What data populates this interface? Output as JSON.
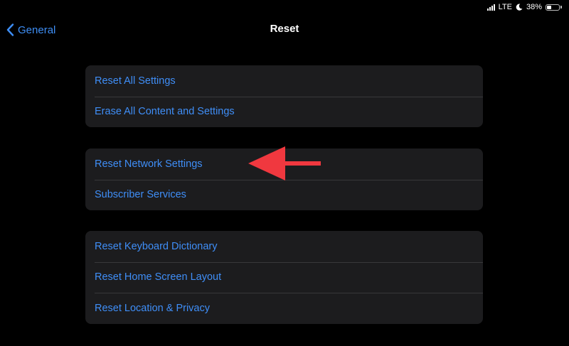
{
  "status_bar": {
    "network": "LTE",
    "battery_percent": "38%",
    "battery_level": 0.38,
    "signal_icon": "signal-bars-icon",
    "moon_icon": "do-not-disturb-moon-icon",
    "battery_icon": "battery-icon"
  },
  "nav": {
    "back_label": "General",
    "back_icon": "chevron-left-icon",
    "title": "Reset"
  },
  "groups": [
    {
      "items": [
        {
          "label": "Reset All Settings"
        },
        {
          "label": "Erase All Content and Settings"
        }
      ]
    },
    {
      "items": [
        {
          "label": "Reset Network Settings"
        },
        {
          "label": "Subscriber Services"
        }
      ]
    },
    {
      "items": [
        {
          "label": "Reset Keyboard Dictionary"
        },
        {
          "label": "Reset Home Screen Layout"
        },
        {
          "label": "Reset Location & Privacy"
        }
      ]
    }
  ],
  "annotation": {
    "icon": "red-arrow-icon",
    "color": "#f0383f"
  },
  "colors": {
    "background": "#000000",
    "group_background": "#1c1c1e",
    "link": "#3f8ef7",
    "separator": "#38383a"
  }
}
